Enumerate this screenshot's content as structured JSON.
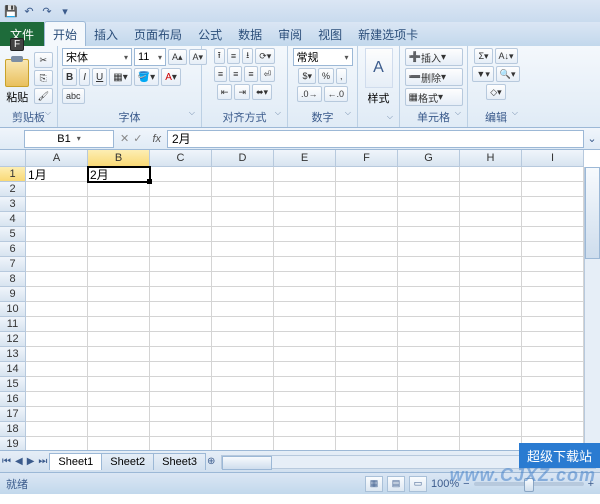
{
  "qat": {
    "items": [
      "save",
      "undo",
      "redo",
      "down"
    ]
  },
  "tabs": {
    "file": "文件",
    "items": [
      "开始",
      "插入",
      "页面布局",
      "公式",
      "数据",
      "审阅",
      "视图",
      "新建选项卡"
    ],
    "active_index": 0
  },
  "keytip": "F",
  "ribbon": {
    "clipboard": {
      "paste": "粘贴",
      "label": "剪贴板"
    },
    "font": {
      "name": "宋体",
      "size": "11",
      "bold": "B",
      "italic": "I",
      "underline": "U",
      "label": "字体"
    },
    "align": {
      "label": "对齐方式"
    },
    "number": {
      "format": "常规",
      "label": "数字"
    },
    "styles": {
      "btn": "样式",
      "label": ""
    },
    "cells": {
      "insert": "插入",
      "delete": "删除",
      "format": "格式",
      "label": "单元格"
    },
    "editing": {
      "label": "编辑"
    }
  },
  "namebox": {
    "ref": "B1",
    "formula": "2月"
  },
  "grid": {
    "cols": [
      "A",
      "B",
      "C",
      "D",
      "E",
      "F",
      "G",
      "H",
      "I"
    ],
    "rows": 19,
    "sel": {
      "col": 1,
      "row": 0
    },
    "cells": {
      "A1": "1月",
      "B1": "2月"
    }
  },
  "sheets": {
    "items": [
      "Sheet1",
      "Sheet2",
      "Sheet3"
    ],
    "active": 0
  },
  "status": {
    "mode": "就绪",
    "zoom": "100%",
    "minus": "−",
    "plus": "+"
  },
  "watermark": {
    "badge": "超级下载站",
    "url": "www.CJXZ.com"
  }
}
